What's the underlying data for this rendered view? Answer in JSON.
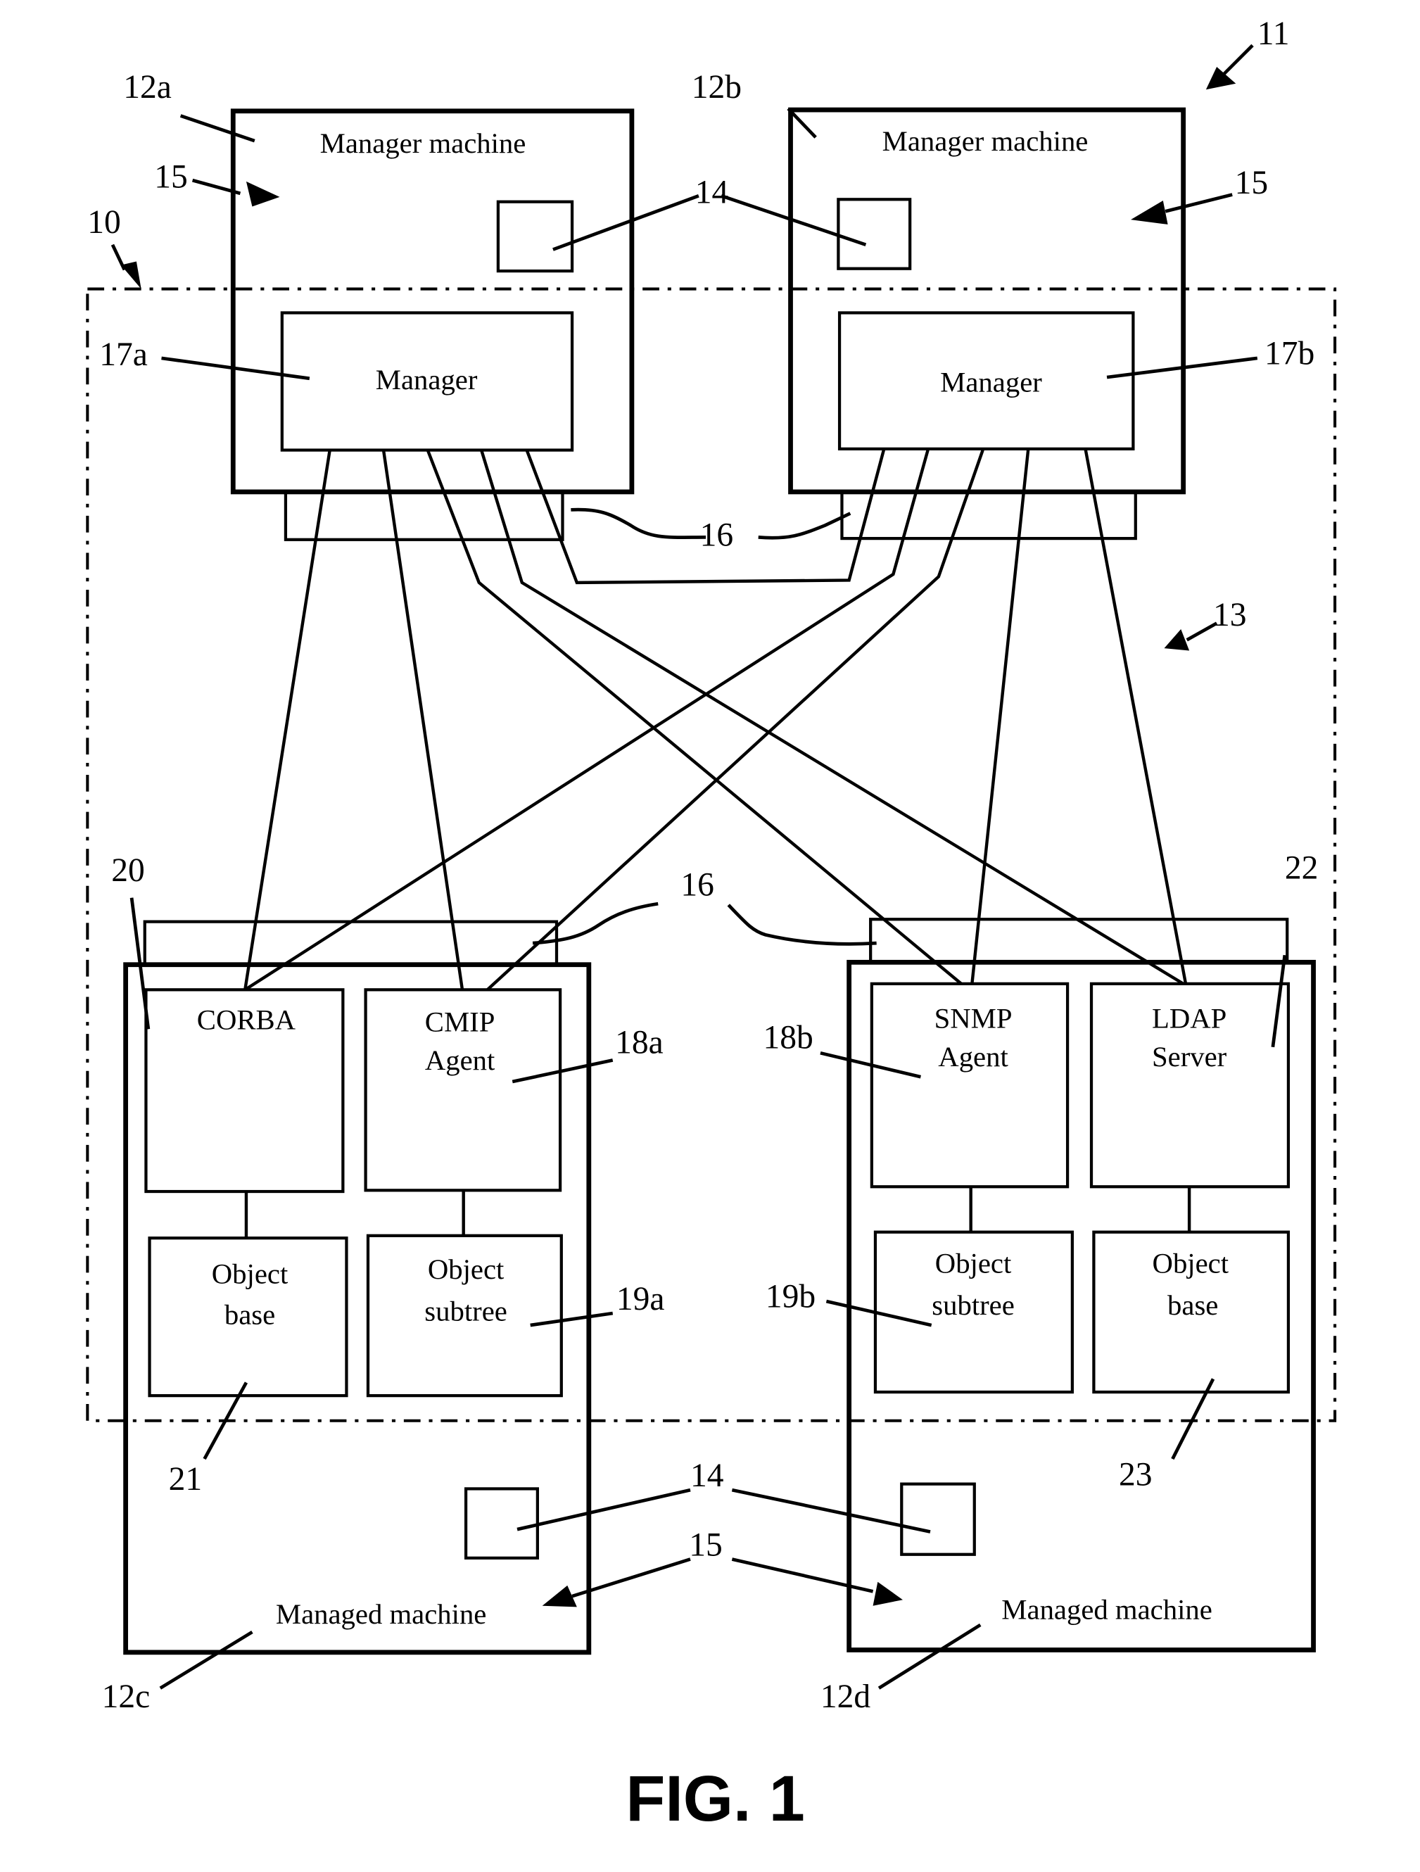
{
  "figure": {
    "caption": "FIG. 1",
    "system_ref": "11",
    "network_ref": "13",
    "domain_ref": "10"
  },
  "manager_machines": [
    {
      "ref": "12a",
      "label": "Manager machine",
      "resource_ref": "15",
      "processor_ref": "14",
      "manager": {
        "ref": "17a",
        "label": "Manager"
      }
    },
    {
      "ref": "12b",
      "label": "Manager machine",
      "resource_ref": "15",
      "processor_ref": "14",
      "manager": {
        "ref": "17b",
        "label": "Manager"
      }
    }
  ],
  "connection_ref": "16",
  "managed_machines": [
    {
      "ref": "12c",
      "label": "Managed machine",
      "components": [
        {
          "ref": "20",
          "label_lines": [
            "CORBA"
          ]
        },
        {
          "ref": "18a",
          "label_lines": [
            "CMIP",
            "Agent"
          ]
        },
        {
          "ref": "21",
          "label_lines": [
            "Object",
            "base"
          ]
        },
        {
          "ref": "19a",
          "label_lines": [
            "Object",
            "subtree"
          ]
        }
      ]
    },
    {
      "ref": "12d",
      "label": "Managed machine",
      "components": [
        {
          "ref": "18b",
          "label_lines": [
            "SNMP",
            "Agent"
          ]
        },
        {
          "ref": "22",
          "label_lines": [
            "LDAP",
            "Server"
          ]
        },
        {
          "ref": "19b",
          "label_lines": [
            "Object",
            "subtree"
          ]
        },
        {
          "ref": "23",
          "label_lines": [
            "Object",
            "base"
          ]
        }
      ]
    }
  ],
  "shared_refs": {
    "processor_ref": "14",
    "resource_ref": "15"
  }
}
